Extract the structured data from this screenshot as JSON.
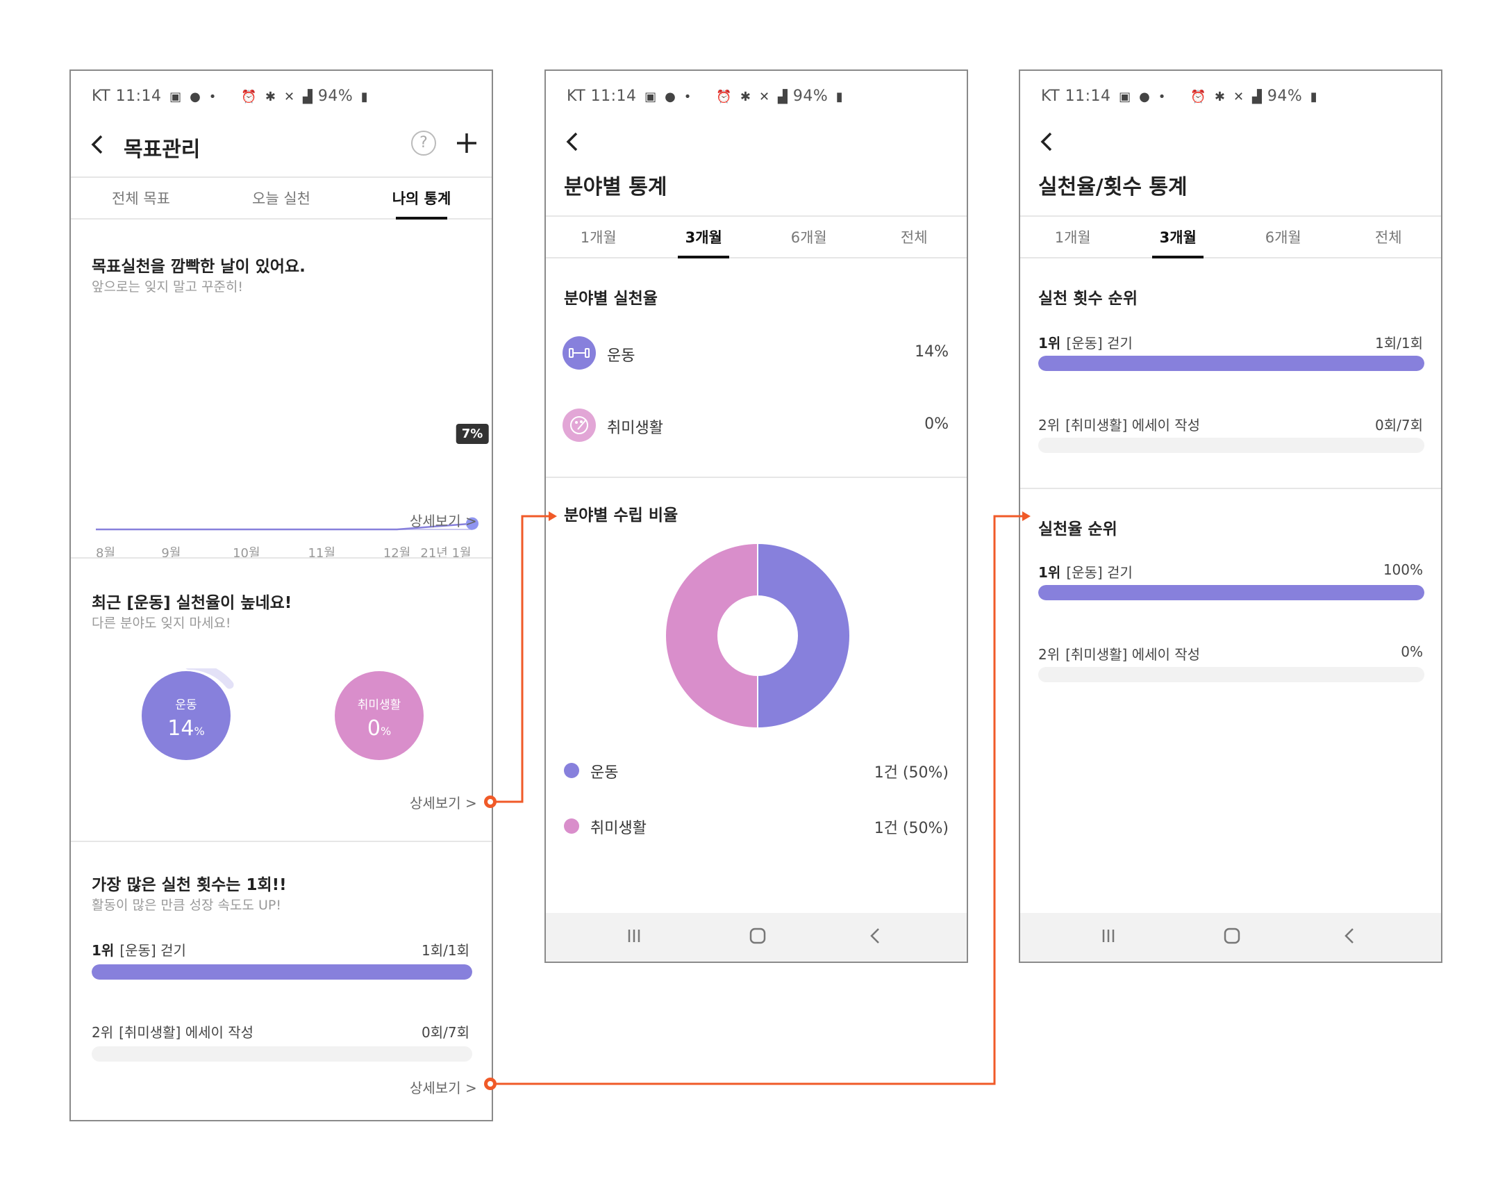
{
  "colors": {
    "purple": "#8780dc",
    "pink": "#d98ecb",
    "accent": "#f05a28",
    "text": "#222222",
    "muted": "#999999"
  },
  "status_bar": {
    "carrier_time": "KT 11:14",
    "battery": "94%",
    "icons": [
      "image-icon",
      "message-icon",
      "alarm-icon",
      "bluetooth-icon",
      "mute-icon",
      "lte-signal-icon",
      "battery-icon"
    ]
  },
  "screen1": {
    "title": "목표관리",
    "tabs": [
      {
        "label": "전체 목표",
        "active": false
      },
      {
        "label": "오늘 실천",
        "active": false
      },
      {
        "label": "나의 통계",
        "active": true
      }
    ],
    "streak": {
      "title": "목표실천을 깜빡한 날이 있어요.",
      "subtitle": "앞으로는 잊지 말고 꾸준히!",
      "tooltip": "7%",
      "months": [
        "8월",
        "9월",
        "10월",
        "11월",
        "12월",
        "21년 1월"
      ],
      "more": "상세보기 >"
    },
    "chart_data": {
      "type": "line",
      "x": [
        "8월",
        "9월",
        "10월",
        "11월",
        "12월",
        "21년 1월"
      ],
      "values": [
        0,
        0,
        0,
        0,
        0,
        7
      ],
      "ylim": [
        0,
        100
      ]
    },
    "category": {
      "title": "최근 [운동] 실천율이 높네요!",
      "subtitle": "다른 분야도 잊지 마세요!",
      "items": [
        {
          "label": "운동",
          "pct": "14",
          "unit": "%",
          "value": 14
        },
        {
          "label": "취미생활",
          "pct": "0",
          "unit": "%",
          "value": 0
        }
      ],
      "more": "상세보기 >"
    },
    "count": {
      "title": "가장 많은 실천 횟수는 1회!!",
      "subtitle": "활동이 많은 만큼 성장 속도도 UP!",
      "ranks": [
        {
          "rank": "1위",
          "label": "[운동] 걷기",
          "value": "1회/1회",
          "fraction": 1.0
        },
        {
          "rank": "2위",
          "label": "[취미생활] 에세이 작성",
          "value": "0회/7회",
          "fraction": 0.0
        }
      ],
      "more": "상세보기 >"
    }
  },
  "screen2": {
    "title": "분야별 통계",
    "tabs": [
      {
        "label": "1개월",
        "active": false
      },
      {
        "label": "3개월",
        "active": true
      },
      {
        "label": "6개월",
        "active": false
      },
      {
        "label": "전체",
        "active": false
      }
    ],
    "rate": {
      "title": "분야별 실천율",
      "items": [
        {
          "name": "운동",
          "value": "14%",
          "icon": "dumbbell-icon"
        },
        {
          "name": "취미생활",
          "value": "0%",
          "icon": "palette-icon"
        }
      ]
    },
    "ratio": {
      "title": "분야별 수립 비율",
      "items": [
        {
          "name": "운동",
          "value": "1건 (50%)"
        },
        {
          "name": "취미생활",
          "value": "1건 (50%)"
        }
      ]
    },
    "chart_data": {
      "type": "pie",
      "categories": [
        "운동",
        "취미생활"
      ],
      "values": [
        50,
        50
      ]
    }
  },
  "screen3": {
    "title": "실천율/횟수 통계",
    "tabs": [
      {
        "label": "1개월",
        "active": false
      },
      {
        "label": "3개월",
        "active": true
      },
      {
        "label": "6개월",
        "active": false
      },
      {
        "label": "전체",
        "active": false
      }
    ],
    "count_rank": {
      "title": "실천 횟수 순위",
      "ranks": [
        {
          "rank": "1위",
          "label": "[운동] 걷기",
          "value": "1회/1회",
          "fraction": 1.0
        },
        {
          "rank": "2위",
          "label": "[취미생활] 에세이 작성",
          "value": "0회/7회",
          "fraction": 0.0
        }
      ]
    },
    "rate_rank": {
      "title": "실천율 순위",
      "ranks": [
        {
          "rank": "1위",
          "label": "[운동] 걷기",
          "value": "100%",
          "fraction": 1.0
        },
        {
          "rank": "2위",
          "label": "[취미생활] 에세이 작성",
          "value": "0%",
          "fraction": 0.0
        }
      ]
    }
  }
}
